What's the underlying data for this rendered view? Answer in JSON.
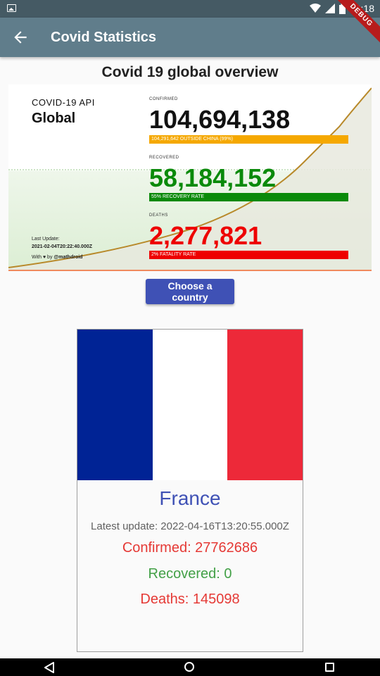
{
  "status_bar": {
    "time": "10:18",
    "debug_label": "DEBUG"
  },
  "app_bar": {
    "title": "Covid Statistics"
  },
  "page": {
    "heading": "Covid 19 global overview"
  },
  "overview": {
    "api_label": "COVID-19 API",
    "scope": "Global",
    "last_update_label": "Last Update:",
    "last_update_value": "2021-02-04T20:22:40.000Z",
    "credit_prefix": "With ♥ by",
    "credit_handle": "@mathdroid",
    "confirmed_label": "CONFIRMED",
    "confirmed_value": "104,694,138",
    "confirmed_sub": "104,291,642 OUTSIDE CHINA (99%)",
    "recovered_label": "RECOVERED",
    "recovered_value": "58,184,152",
    "recovered_sub": "55% RECOVERY RATE",
    "deaths_label": "DEATHS",
    "deaths_value": "2,277,821",
    "deaths_sub": "2% FATALITY RATE",
    "colors": {
      "confirmed": "#111111",
      "confirmed_bar": "#f5a800",
      "recovered": "#0a8a0a",
      "recovered_bar": "#0a8a0a",
      "deaths": "#ee0000",
      "deaths_bar": "#ee0000"
    }
  },
  "button": {
    "label": "Choose a country"
  },
  "country_card": {
    "flag_colors": [
      "#002395",
      "#ffffff",
      "#ed2939"
    ],
    "name": "France",
    "latest_update": "Latest update: 2022-04-16T13:20:55.000Z",
    "confirmed": "Confirmed: 27762686",
    "recovered": "Recovered: 0",
    "deaths": "Deaths: 145098",
    "colors": {
      "name": "#3f51b5",
      "confirmed": "#e53935",
      "recovered": "#43a047",
      "deaths": "#e53935"
    }
  }
}
